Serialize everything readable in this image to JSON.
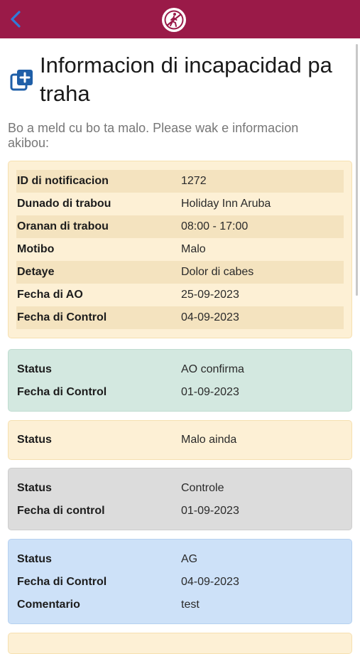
{
  "topbar": {
    "back_icon": "chevron-left-icon",
    "logo_icon": "walking-person-logo"
  },
  "header": {
    "icon": "add-document-icon",
    "title": "Informacion di incapacidad pa traha"
  },
  "subtitle": "Bo a meld cu bo ta malo. Please wak e informacion akibou:",
  "colors": {
    "brand": "#9a1a48",
    "accent_blue": "#2f7bd9",
    "card_yellow": "#fdf0d5",
    "card_green": "#d3e8e0",
    "card_gray": "#dcdcdc",
    "card_blue": "#cde1f8"
  },
  "main_info": [
    {
      "label": "ID di notificacion",
      "value": "1272"
    },
    {
      "label": "Dunado di trabou",
      "value": "Holiday Inn Aruba"
    },
    {
      "label": "Oranan di trabou",
      "value": "08:00 - 17:00"
    },
    {
      "label": "Motibo",
      "value": "Malo"
    },
    {
      "label": "Detaye",
      "value": "Dolor di cabes"
    },
    {
      "label": "Fecha di AO",
      "value": "25-09-2023"
    },
    {
      "label": "Fecha di Control",
      "value": "04-09-2023"
    }
  ],
  "status_cards": [
    {
      "rows": [
        {
          "label": "Status",
          "value": "AO confirma"
        },
        {
          "label": "Fecha di Control",
          "value": "01-09-2023"
        }
      ]
    },
    {
      "rows": [
        {
          "label": "Status",
          "value": "Malo ainda"
        }
      ]
    },
    {
      "rows": [
        {
          "label": "Status",
          "value": "Controle"
        },
        {
          "label": "Fecha di control",
          "value": "01-09-2023"
        }
      ]
    },
    {
      "rows": [
        {
          "label": "Status",
          "value": "AG"
        },
        {
          "label": "Fecha di Control",
          "value": "04-09-2023"
        },
        {
          "label": "Comentario",
          "value": "test"
        }
      ]
    }
  ]
}
